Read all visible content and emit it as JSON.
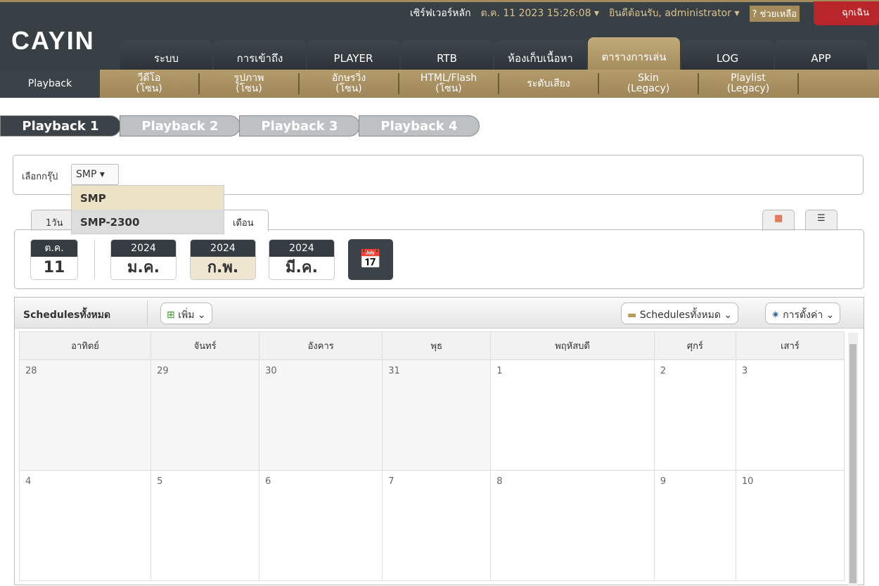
{
  "header": {
    "logo": "CAYIN",
    "server": "เซิร์ฟเวอร์หลัก",
    "datetime": "ต.ค. 11 2023 15:26:08",
    "welcome": "ยินดีต้อนรับ, administrator",
    "help": "ช่วยเหลือ",
    "emergency": "ฉุกเฉิน"
  },
  "nav": [
    {
      "label": "ระบบ"
    },
    {
      "label": "การเข้าถึง"
    },
    {
      "label": "PLAYER"
    },
    {
      "label": "RTB"
    },
    {
      "label": "ห้องเก็บเนื้อหา"
    },
    {
      "label": "ตารางการเล่น",
      "active": true
    },
    {
      "label": "LOG"
    },
    {
      "label": "APP"
    }
  ],
  "subnav": [
    "Playback",
    "วีดีโอ\n(โซน)",
    "รูปภาพ\n(โซน)",
    "อักษรวิ่ง\n(โซน)",
    "HTML/Flash\n(โซน)",
    "ระดับเสียง",
    "Skin\n(Legacy)",
    "Playlist\n(Legacy)"
  ],
  "playback_tabs": [
    "Playback 1",
    "Playback 2",
    "Playback 3",
    "Playback 4"
  ],
  "group": {
    "label": "เลือกกรุ๊ป",
    "selected": "SMP",
    "options": [
      "SMP",
      "SMP-2300"
    ]
  },
  "view_tabs": [
    "1วัน",
    "เดือน"
  ],
  "dates": {
    "today_month": "ต.ค.",
    "today_day": "11",
    "months": [
      {
        "year": "2024",
        "month": "ม.ค."
      },
      {
        "year": "2024",
        "month": "ก.พ.",
        "active": true
      },
      {
        "year": "2024",
        "month": "มี.ค."
      }
    ]
  },
  "schedules": {
    "title": "Schedulesทั้งหมด",
    "add": "เพิ่ม",
    "filter": "Schedulesทั้งหมด",
    "settings": "การตั้งค่า"
  },
  "calendar": {
    "weekdays": [
      "อาทิตย์",
      "จันทร์",
      "อังคาร",
      "พุธ",
      "พฤหัสบดี",
      "ศุกร์",
      "เสาร์"
    ],
    "weeks": [
      [
        "28",
        "29",
        "30",
        "31",
        "1",
        "2",
        "3"
      ],
      [
        "4",
        "5",
        "6",
        "7",
        "8",
        "9",
        "10"
      ]
    ]
  }
}
